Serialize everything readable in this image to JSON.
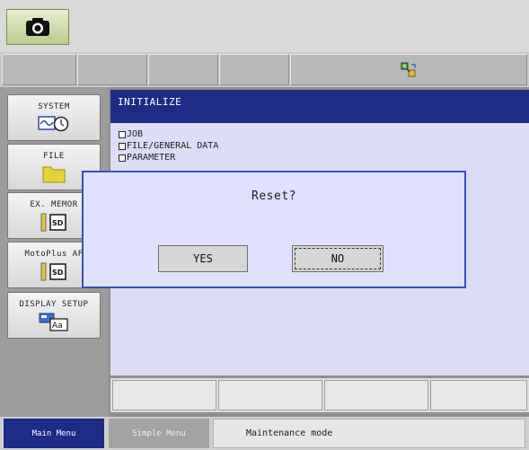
{
  "menu": {
    "items": [
      {
        "label": "SYSTEM",
        "icon": "system-clock-icon"
      },
      {
        "label": "FILE",
        "icon": "folder-icon"
      },
      {
        "label": "EX. MEMOR",
        "icon": "sd-card-icon"
      },
      {
        "label": "MotoPlus AF",
        "icon": "sd-card-icon"
      },
      {
        "label": "DISPLAY SETUP",
        "icon": "display-font-icon"
      }
    ]
  },
  "main": {
    "title": "INITIALIZE",
    "items": [
      "JOB",
      "FILE/GENERAL DATA",
      "PARAMETER"
    ]
  },
  "dialog": {
    "message": "Reset?",
    "yes_label": "YES",
    "no_label": "NO"
  },
  "statusbar": {
    "main_menu_label": "Main Menu",
    "simple_menu_label": "Simple Menu",
    "mode_text": "Maintenance mode"
  },
  "colors": {
    "title_bar": "#1d2c86",
    "content_bg": "#dcdcf6",
    "dialog_bg": "#dfe1ff",
    "dialog_border": "#3b50b8"
  }
}
